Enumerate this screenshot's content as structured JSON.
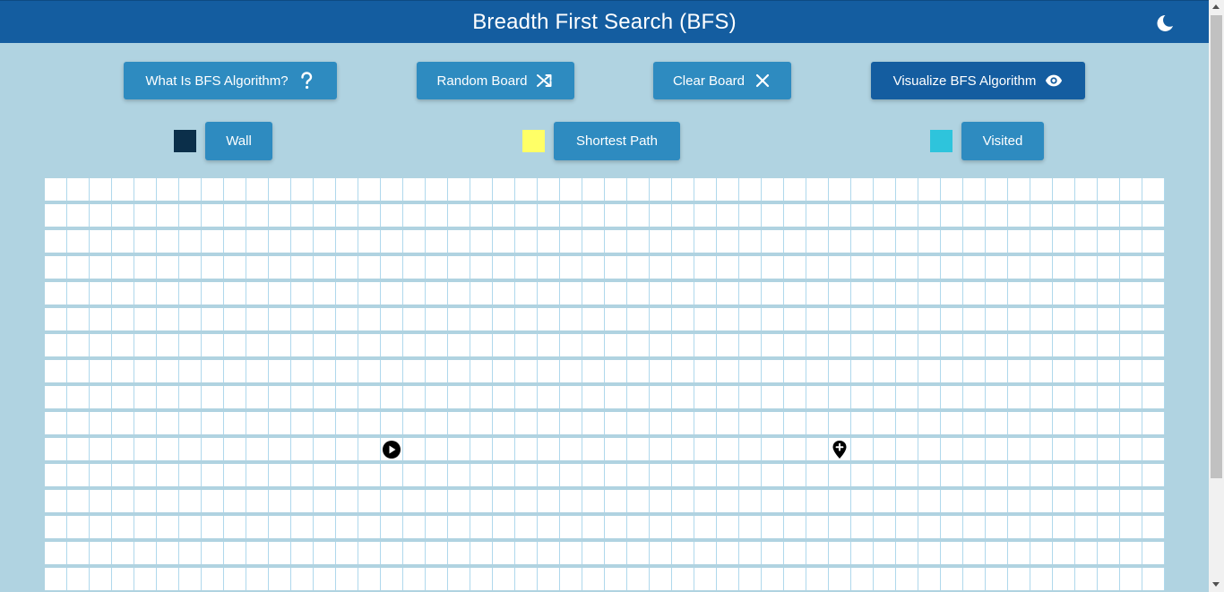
{
  "header": {
    "title": "Breadth First Search (BFS)",
    "theme_icon": "moon-icon"
  },
  "toolbar": {
    "info_label": "What Is BFS Algorithm?",
    "random_label": "Random Board",
    "clear_label": "Clear Board",
    "visualize_label": "Visualize BFS Algorithm"
  },
  "legend": {
    "wall_label": "Wall",
    "path_label": "Shortest Path",
    "visited_label": "Visited"
  },
  "colors": {
    "header_bg": "#145da0",
    "button_bg": "#2e8bc0",
    "page_bg": "#b0d3e1",
    "wall": "#0b2f4a",
    "shortest_path": "#ffff66",
    "visited": "#2ec4dc",
    "cell_border": "#afd8ec"
  },
  "grid": {
    "columns": 50,
    "visible_rows": 16,
    "start": {
      "row": 10,
      "col": 15,
      "icon": "play-circle-icon"
    },
    "target": {
      "row": 10,
      "col": 35,
      "icon": "map-pin-plus-icon"
    }
  }
}
